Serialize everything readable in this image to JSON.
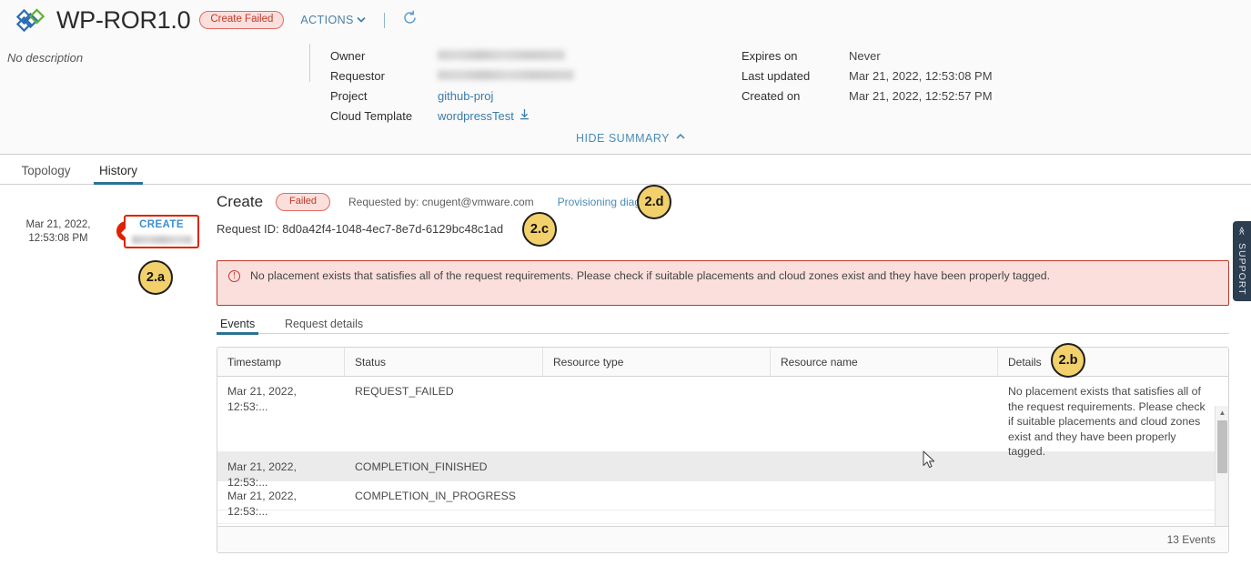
{
  "header": {
    "app_title": "WP-ROR1.0",
    "status_badge": "Create Failed",
    "actions_label": "ACTIONS",
    "chevron_icon": "chevron-down-icon",
    "refresh_icon": "refresh-icon",
    "description": "No description",
    "hide_summary_label": "HIDE SUMMARY",
    "hide_summary_icon": "chevron-up-icon",
    "meta_left": [
      {
        "label": "Owner",
        "value": "",
        "redacted": true
      },
      {
        "label": "Requestor",
        "value": "",
        "redacted": true
      },
      {
        "label": "Project",
        "value": "github-proj",
        "link": true
      },
      {
        "label": "Cloud Template",
        "value": "wordpressTest",
        "link": true,
        "icon": "download-icon"
      }
    ],
    "meta_right": [
      {
        "label": "Expires on",
        "value": "Never"
      },
      {
        "label": "Last updated",
        "value": "Mar 21, 2022, 12:53:08 PM"
      },
      {
        "label": "Created on",
        "value": "Mar 21, 2022, 12:52:57 PM"
      }
    ]
  },
  "main_tabs": [
    {
      "label": "Topology",
      "active": false
    },
    {
      "label": "History",
      "active": true
    }
  ],
  "timeline": {
    "date_line1": "Mar 21, 2022,",
    "date_line2": "12:53:08 PM",
    "error_icon": "error-exclamation-icon",
    "card_label": "CREATE",
    "card_subtitle_redacted": true
  },
  "detail": {
    "title": "Create",
    "status_badge": "Failed",
    "requested_by": "Requested by: cnugent@vmware.com",
    "provisioning_diagram_link": "Provisioning diagram",
    "request_id": "Request ID: 8d0a42f4-1048-4ec7-8e7d-6129bc48c1ad"
  },
  "alert": {
    "icon": "error-circle-icon",
    "message": "No placement exists that satisfies all of the request requirements. Please check if suitable placements and cloud zones exist and they have been properly tagged."
  },
  "sub_tabs": [
    {
      "label": "Events",
      "active": true
    },
    {
      "label": "Request details",
      "active": false
    }
  ],
  "table": {
    "columns": [
      "Timestamp",
      "Status",
      "Resource type",
      "Resource name",
      "Details"
    ],
    "rows": [
      {
        "timestamp": "Mar 21, 2022, 12:53:...",
        "status": "REQUEST_FAILED",
        "resource_type": "",
        "resource_name": "",
        "details": "No placement exists that satisfies all of the request requirements. Please check if suitable placements and cloud zones exist and they have been properly tagged."
      },
      {
        "timestamp": "Mar 21, 2022, 12:53:...",
        "status": "COMPLETION_FINISHED",
        "resource_type": "",
        "resource_name": "",
        "details": ""
      },
      {
        "timestamp": "Mar 21, 2022, 12:53:...",
        "status": "COMPLETION_IN_PROGRESS",
        "resource_type": "",
        "resource_name": "",
        "details": ""
      }
    ],
    "footer_count": "13 Events",
    "scroll_up_icon": "triangle-up-icon",
    "scroll_down_icon": "triangle-down-icon"
  },
  "support": {
    "label": "SUPPORT",
    "icon": "double-chevron-left-icon"
  },
  "callouts": [
    {
      "id": "2.a",
      "label": "2.a"
    },
    {
      "id": "2.b",
      "label": "2.b"
    },
    {
      "id": "2.c",
      "label": "2.c"
    },
    {
      "id": "2.d",
      "label": "2.d"
    }
  ],
  "colors": {
    "accent_blue": "#2d7294",
    "link_blue": "#4a8cb8",
    "error_red": "#c0392b",
    "error_bg": "#fbdfdc",
    "callout_yellow": "#f2d06b"
  }
}
